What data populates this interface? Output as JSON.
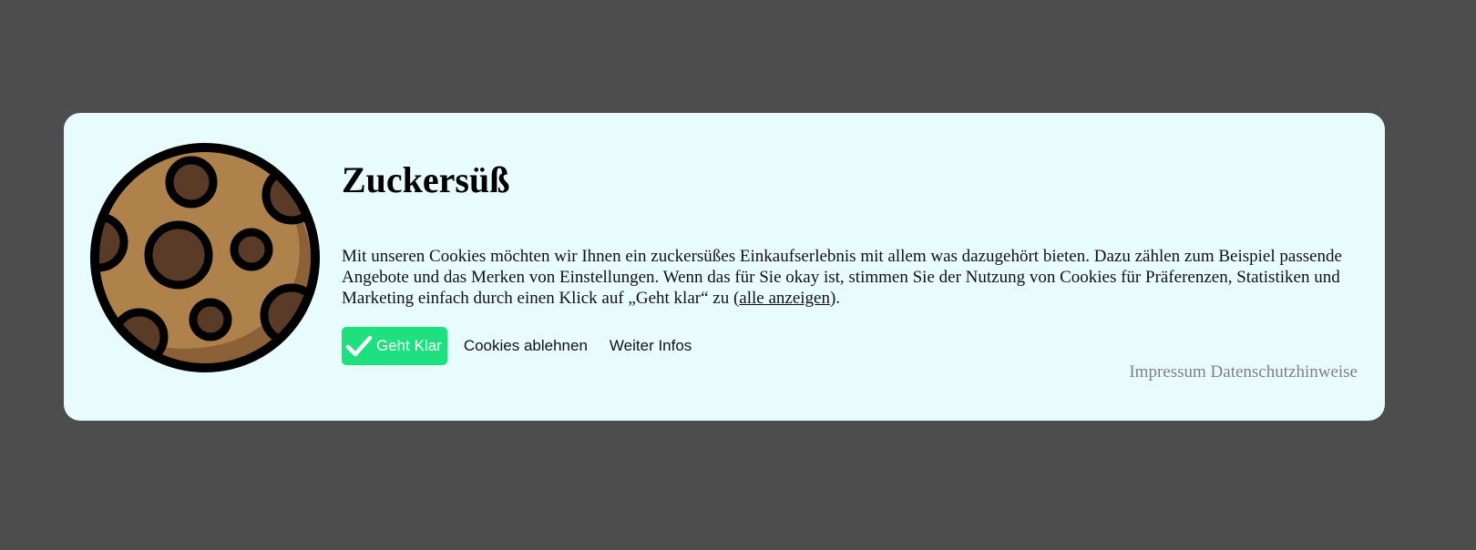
{
  "dialog": {
    "title": "Zuckersüß",
    "description_before_link": "Mit unseren Cookies möchten wir Ihnen ein zuckersüßes Einkaufserlebnis mit allem was dazugehört bieten. Dazu zählen zum Beispiel passende Angebote und das Merken von Einstellungen. Wenn das für Sie okay ist, stimmen Sie der Nutzung von Cookies für Präferenzen, Statistiken und Marketing einfach durch einen Klick auf „Geht klar“ zu (",
    "description_link": "alle anzeigen",
    "description_after_link": ").",
    "icon": "cookie-icon"
  },
  "actions": {
    "accept_label": "Geht Klar",
    "accept_icon": "check-icon",
    "decline_label": "Cookies ablehnen",
    "more_info_label": "Weiter Infos"
  },
  "footer": {
    "impressum_label": "Impressum",
    "privacy_label": "Datenschutzhinweise"
  },
  "colors": {
    "overlay": "#4d4d4d",
    "dialog_background": "#e9fcfd",
    "accept_button": "#1ee07f",
    "cookie_dough": "#b0824b",
    "cookie_shadow": "#8c6137",
    "chocolate_chip": "#5a3b28",
    "footer_link": "#808080"
  }
}
